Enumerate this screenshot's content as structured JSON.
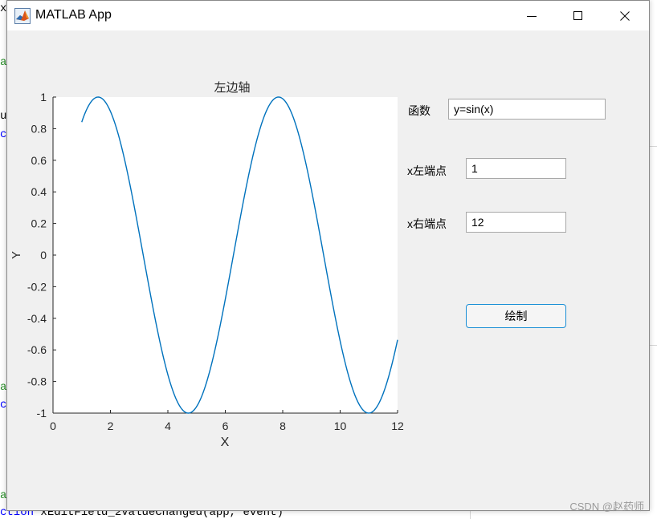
{
  "editor_background": {
    "lines": [
      {
        "text": "x",
        "color": "#000000"
      },
      {
        "text": "a",
        "color": "#228b22"
      },
      {
        "text": "u",
        "color": "#000000"
      },
      {
        "text": "c",
        "color": "#0000ff"
      },
      {
        "text": "a",
        "color": "#228b22"
      },
      {
        "text": "c",
        "color": "#0000ff"
      },
      {
        "text": "a",
        "color": "#228b22"
      },
      {
        "keyword": "ction",
        "rest": " xEditField_2ValueChanged(app, event)"
      }
    ]
  },
  "window": {
    "title": "MATLAB App",
    "controls": [
      "minimize-icon",
      "maximize-icon",
      "close-icon"
    ]
  },
  "axes": {
    "title": "左边轴",
    "xlabel": "X",
    "ylabel": "Y"
  },
  "chart_data": {
    "type": "line",
    "title": "左边轴",
    "xlabel": "X",
    "ylabel": "Y",
    "xlim": [
      0,
      12
    ],
    "ylim": [
      -1,
      1
    ],
    "xticks": [
      0,
      2,
      4,
      6,
      8,
      10,
      12
    ],
    "yticks": [
      -1,
      -0.8,
      -0.6,
      -0.4,
      -0.2,
      0,
      0.2,
      0.4,
      0.6,
      0.8,
      1
    ],
    "grid": false,
    "series": [
      {
        "function": "y=sin(x)",
        "x_range": [
          1,
          12
        ],
        "color": "#0072bd"
      }
    ]
  },
  "form": {
    "function_label": "函数",
    "function_value": "y=sin(x)",
    "x_left_label": "x左端点",
    "x_left_value": "1",
    "x_right_label": "x右端点",
    "x_right_value": "12",
    "draw_button": "绘制"
  },
  "watermark": "CSDN @赵药师"
}
